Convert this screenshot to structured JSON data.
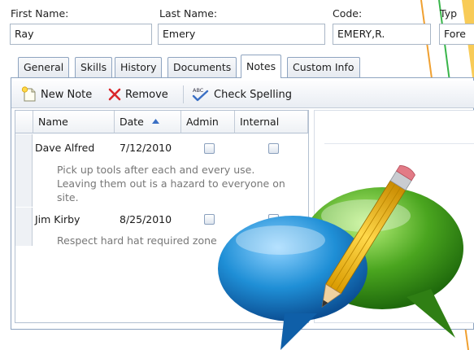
{
  "form": {
    "first_name_label": "First Name:",
    "first_name_value": "Ray",
    "last_name_label": "Last Name:",
    "last_name_value": "Emery",
    "code_label": "Code:",
    "code_value": "EMERY,R.",
    "type_label": "Typ",
    "type_value": "Fore"
  },
  "tabs": [
    {
      "label": "General"
    },
    {
      "label": "Skills"
    },
    {
      "label": "History"
    },
    {
      "label": "Documents"
    },
    {
      "label": "Notes",
      "active": true
    },
    {
      "label": "Custom Info"
    }
  ],
  "toolbar": {
    "new_note_label": "New Note",
    "remove_label": "Remove",
    "check_spelling_label": "Check Spelling",
    "spell_icon_text": "ABC"
  },
  "grid": {
    "columns": [
      "Name",
      "Date",
      "Admin",
      "Internal"
    ],
    "sort_column": "Date",
    "rows": [
      {
        "name": "Dave Alfred",
        "date": "7/12/2010",
        "admin": false,
        "internal": false,
        "note_lines": [
          "Pick up tools after each and every use.",
          "Leaving them out is a hazard to everyone on",
          "site."
        ]
      },
      {
        "name": "Jim Kirby",
        "date": "8/25/2010",
        "admin": false,
        "internal": false,
        "note_lines": [
          "Respect hard hat required zone"
        ]
      }
    ]
  },
  "colors": {
    "tab_border": "#8ea4c0",
    "remove_icon": "#d9262b",
    "bubble_blue": "#1f8fd6",
    "bubble_green": "#4aa51f",
    "pencil_yellow": "#f2c21a",
    "line_orange": "#f0a030",
    "line_green": "#39b54a"
  }
}
